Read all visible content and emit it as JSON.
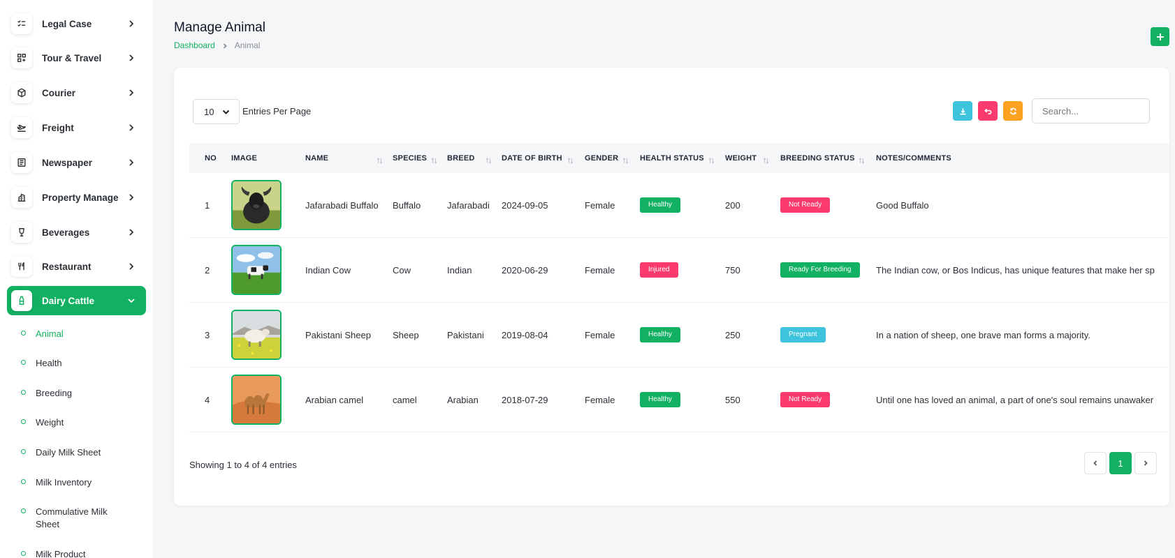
{
  "sidebar": {
    "items": [
      {
        "label": "Legal Case",
        "icon": "checklist-icon"
      },
      {
        "label": "Tour & Travel",
        "icon": "grid-plus-icon"
      },
      {
        "label": "Courier",
        "icon": "box-icon"
      },
      {
        "label": "Freight",
        "icon": "plane-icon"
      },
      {
        "label": "Newspaper",
        "icon": "newspaper-icon"
      },
      {
        "label": "Property Manage",
        "icon": "building-icon"
      },
      {
        "label": "Beverages",
        "icon": "glass-icon"
      },
      {
        "label": "Restaurant",
        "icon": "fork-knife-icon"
      },
      {
        "label": "Dairy Cattle",
        "icon": "milk-bottle-icon",
        "active": true
      }
    ],
    "subitems": [
      {
        "label": "Animal",
        "active": true
      },
      {
        "label": "Health"
      },
      {
        "label": "Breeding"
      },
      {
        "label": "Weight"
      },
      {
        "label": "Daily Milk Sheet"
      },
      {
        "label": "Milk Inventory"
      },
      {
        "label": "Commulative Milk Sheet"
      },
      {
        "label": "Milk Product"
      }
    ]
  },
  "header": {
    "title": "Manage Animal",
    "breadcrumb": {
      "home": "Dashboard",
      "current": "Animal"
    },
    "add_icon": "plus-icon"
  },
  "toolbar": {
    "entries_value": "10",
    "entries_label": "Entries Per Page",
    "search_placeholder": "Search...",
    "buttons": [
      {
        "icon": "download-icon",
        "color": "#3ec3dc"
      },
      {
        "icon": "undo-icon",
        "color": "#fb3b6e"
      },
      {
        "icon": "refresh-icon",
        "color": "#fca120"
      }
    ]
  },
  "table": {
    "columns": [
      "NO",
      "IMAGE",
      "NAME",
      "SPECIES",
      "BREED",
      "DATE OF BIRTH",
      "GENDER",
      "HEALTH STATUS",
      "WEIGHT",
      "BREEDING STATUS",
      "NOTES/COMMENTS"
    ],
    "rows": [
      {
        "no": "1",
        "image": "buffalo-photo",
        "name": "Jafarabadi Buffalo",
        "species": "Buffalo",
        "breed": "Jafarabadi",
        "dob": "2024-09-05",
        "gender": "Female",
        "health": "Healthy",
        "weight": "200",
        "breeding": "Not Ready",
        "notes": "Good Buffalo"
      },
      {
        "no": "2",
        "image": "cow-photo",
        "name": "Indian Cow",
        "species": "Cow",
        "breed": "Indian",
        "dob": "2020-06-29",
        "gender": "Female",
        "health": "Injured",
        "weight": "750",
        "breeding": "Ready For Breeding",
        "notes": "The Indian cow, or Bos Indicus, has unique features that make her sp"
      },
      {
        "no": "3",
        "image": "sheep-photo",
        "name": "Pakistani Sheep",
        "species": "Sheep",
        "breed": "Pakistani",
        "dob": "2019-08-04",
        "gender": "Female",
        "health": "Healthy",
        "weight": "250",
        "breeding": "Pregnant",
        "notes": "In a nation of sheep, one brave man forms a majority."
      },
      {
        "no": "4",
        "image": "camel-photo",
        "name": "Arabian camel",
        "species": "camel",
        "breed": "Arabian",
        "dob": "2018-07-29",
        "gender": "Female",
        "health": "Healthy",
        "weight": "550",
        "breeding": "Not Ready",
        "notes": "Until one has loved an animal, a part of one's soul remains unawaker"
      }
    ]
  },
  "status_colors": {
    "Healthy": "#12b062",
    "Injured": "#fb3b6e",
    "Not Ready": "#fb3b6e",
    "Ready For Breeding": "#12b062",
    "Pregnant": "#3ec3dc"
  },
  "footer": {
    "info": "Showing 1 to 4 of 4 entries",
    "current_page": "1"
  },
  "colors": {
    "accent": "#12b062"
  }
}
